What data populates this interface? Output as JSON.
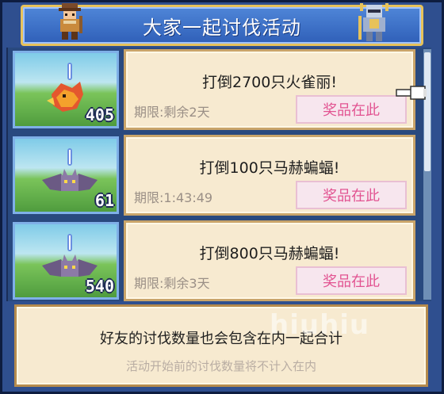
{
  "header": {
    "title": "大家一起讨伐活动"
  },
  "missions": [
    {
      "goal": "打倒2700只火雀丽!",
      "deadline": "期限:剩余2天",
      "prize_label": "奖品在此",
      "count": "405",
      "monster": "fire-bird-icon"
    },
    {
      "goal": "打倒100只马赫蝙蝠!",
      "deadline": "期限:1:43:49",
      "prize_label": "奖品在此",
      "count": "61",
      "monster": "bat-icon"
    },
    {
      "goal": "打倒800只马赫蝙蝠!",
      "deadline": "期限:剩余3天",
      "prize_label": "奖品在此",
      "count": "540",
      "monster": "bat-icon"
    }
  ],
  "footer": {
    "line1": "好友的讨伐数量也会包含在内一起合计",
    "line2": "活动开始前的讨伐数量将不计入在内"
  },
  "watermark": "hiuhiu",
  "colors": {
    "header_bg": "#2f5fb8",
    "header_border": "#e7c25a",
    "card_bg": "#f7ead0",
    "prize_text": "#e25391"
  }
}
